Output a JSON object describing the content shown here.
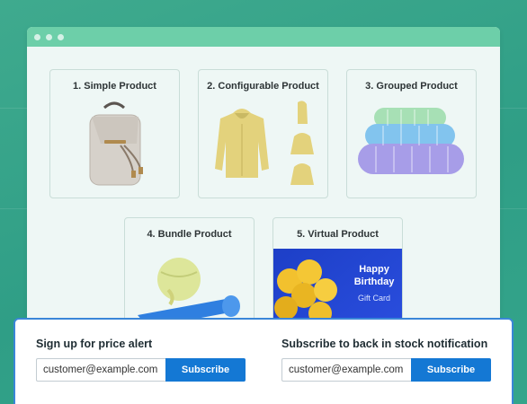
{
  "window": {
    "controls": [
      "close-dot",
      "minimize-dot",
      "maximize-dot"
    ]
  },
  "products": [
    {
      "title": "1. Simple Product",
      "image": "backpack"
    },
    {
      "title": "2. Configurable Product",
      "image": "hoodie-variants"
    },
    {
      "title": "3. Grouped Product",
      "image": "foam-rollers"
    },
    {
      "title": "4. Bundle Product",
      "image": "exercise-ball-and-mat"
    },
    {
      "title": "5. Virtual Product",
      "image": "gift-card"
    }
  ],
  "gift_card": {
    "line1": "Happy",
    "line2": "Birthday",
    "line3": "Gift Card"
  },
  "price_alert": {
    "heading": "Sign up for price alert",
    "email_value": "customer@example.com",
    "button_label": "Subscribe"
  },
  "stock_alert": {
    "heading": "Subscribe to back in stock notification",
    "email_value": "customer@example.com",
    "button_label": "Subscribe"
  },
  "colors": {
    "background": "#34a58b",
    "titlebar": "#6dcfa9",
    "button": "#1478d4",
    "panel_border": "#3a86d8"
  }
}
